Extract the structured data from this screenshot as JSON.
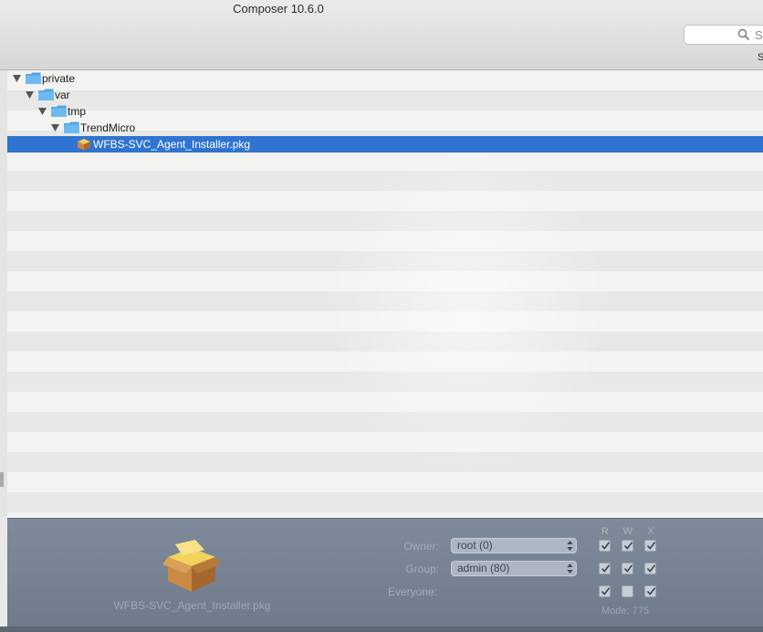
{
  "window": {
    "title": "Composer 10.6.0"
  },
  "toolbar": {
    "search_placeholder": "S",
    "label_fragment": "S"
  },
  "tree": [
    {
      "label": "private",
      "type": "folder",
      "level": 0,
      "expanded": true,
      "selected": false
    },
    {
      "label": "var",
      "type": "folder",
      "level": 1,
      "expanded": true,
      "selected": false
    },
    {
      "label": "tmp",
      "type": "folder",
      "level": 2,
      "expanded": true,
      "selected": false
    },
    {
      "label": "TrendMicro",
      "type": "folder",
      "level": 3,
      "expanded": true,
      "selected": false
    },
    {
      "label": "WFBS-SVC_Agent_Installer.pkg",
      "type": "package",
      "level": 4,
      "expanded": false,
      "selected": true
    }
  ],
  "inspector": {
    "item_name": "WFBS-SVC_Agent_Installer.pkg",
    "owner_label": "Owner:",
    "owner_value": "root (0)",
    "group_label": "Group:",
    "group_value": "admin (80)",
    "everyone_label": "Everyone:",
    "perm_headers": [
      "R",
      "W",
      "X"
    ],
    "permissions": {
      "owner": [
        true,
        true,
        true
      ],
      "group": [
        true,
        true,
        true
      ],
      "everyone": [
        true,
        false,
        true
      ]
    },
    "mode_text": "Mode: 775"
  },
  "colors": {
    "selection": "#2f74d0",
    "folder": "#5ab0e6",
    "inspector_bg": "#7a8696"
  }
}
